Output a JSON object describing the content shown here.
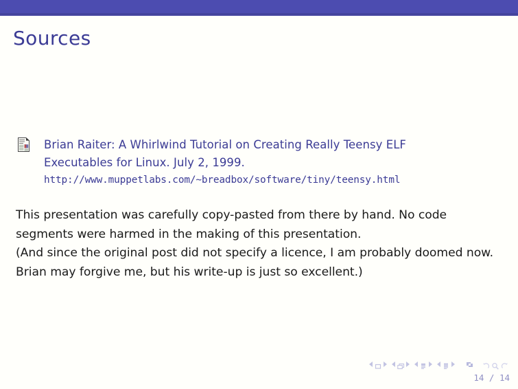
{
  "theme": {
    "bar_color": "#4c4cb0",
    "bar_shadow_color": "#44449e",
    "accent_text_color": "#3b3b95",
    "body_text_color": "#1a1a1a",
    "background_color": "#fffffb",
    "nav_color": "#9ea0d4"
  },
  "slide": {
    "title": "Sources"
  },
  "bibliography": {
    "icon": "article-document-icon",
    "entries": [
      {
        "line1": "Brian Raiter: A Whirlwind Tutorial on Creating Really Teensy ELF",
        "line2": "Executables for Linux. July 2, 1999.",
        "url": "http://www.muppetlabs.com/~breadbox/software/tiny/teensy.html"
      }
    ]
  },
  "body": {
    "paragraphs": [
      {
        "lines": [
          "This presentation was carefully copy-pasted from there by hand.  No code",
          "segments were harmed in the making of this presentation."
        ]
      },
      {
        "lines": [
          "(And since the original post did not specify a licence, I am probably doomed now.",
          "Brian may forgive me, but his write-up is just so excellent.)"
        ]
      }
    ]
  },
  "navigation": {
    "groups": [
      {
        "name": "slide",
        "icon": "slide-square-icon"
      },
      {
        "name": "frame",
        "icon": "frame-stack-icon"
      },
      {
        "name": "subsection",
        "icon": "subsection-icon"
      },
      {
        "name": "section",
        "icon": "section-icon"
      }
    ],
    "presentation_icon": "presentation-icon",
    "back_icon": "back-arrow-icon",
    "find_icon": "magnifier-icon",
    "forward_icon": "forward-arrow-icon",
    "page_label": "14 / 14",
    "current_page": 14,
    "total_pages": 14
  }
}
